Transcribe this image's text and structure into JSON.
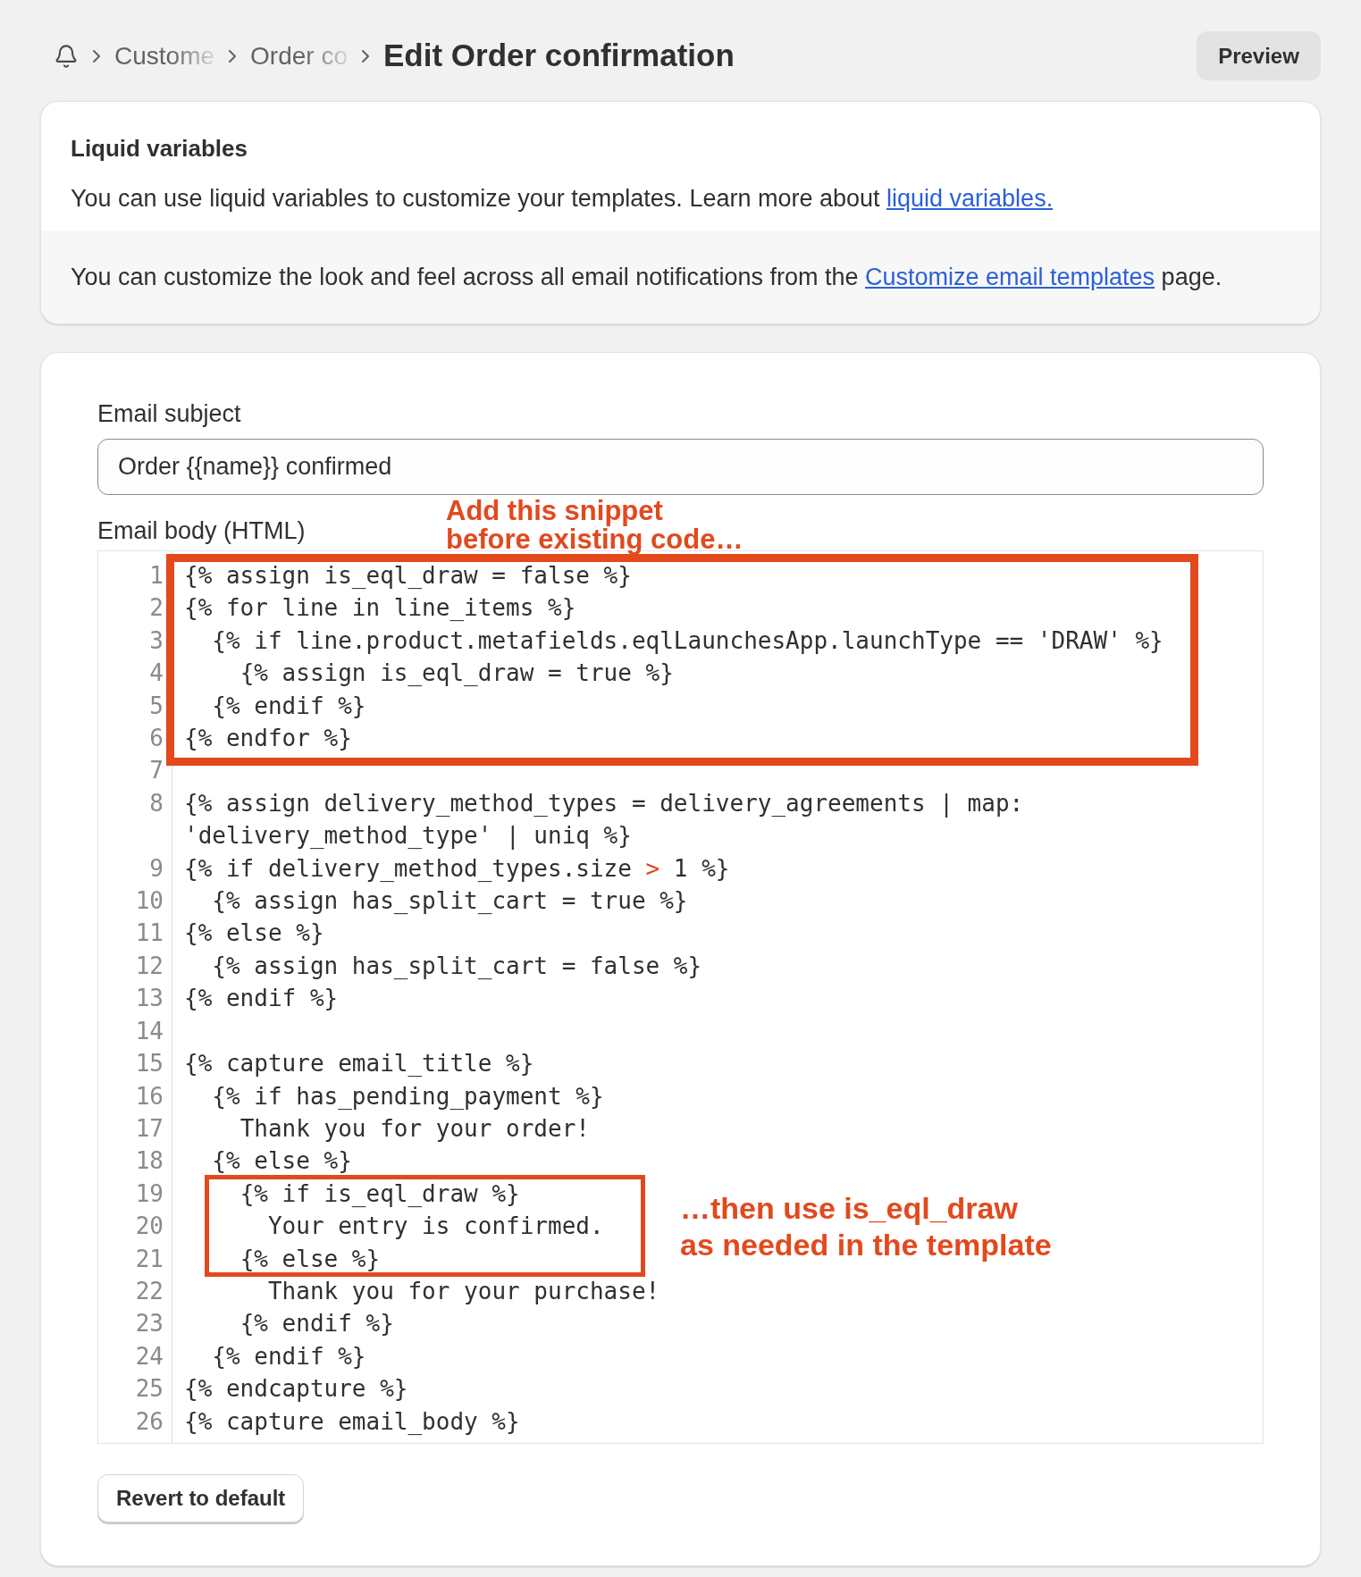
{
  "breadcrumbs": [
    {
      "label": "Custome"
    },
    {
      "label": "Order co"
    }
  ],
  "page_title": "Edit Order confirmation",
  "header_action": {
    "label": "Preview"
  },
  "info_card": {
    "title": "Liquid variables",
    "intro": {
      "text": "You can use liquid variables to customize your templates. Learn more about ",
      "link": "liquid variables."
    },
    "footer": {
      "text_before": "You can customize the look and feel across all email notifications from the ",
      "link": "Customize email templates",
      "text_after": " page."
    }
  },
  "form": {
    "subject": {
      "label": "Email subject",
      "value": "Order {{name}} confirmed"
    },
    "body": {
      "label": "Email body (HTML)",
      "lines": [
        {
          "number": "1",
          "tokens": [
            {
              "kind": "plain",
              "text": "{% assign is_eql_draw = false %}"
            }
          ]
        },
        {
          "number": "2",
          "tokens": [
            {
              "kind": "plain",
              "text": "{% for line in line_items %}"
            }
          ]
        },
        {
          "number": "3",
          "tokens": [
            {
              "kind": "plain",
              "text": "  {% if line.product.metafields.eqlLaunchesApp.launchType == 'DRAW' %}"
            }
          ]
        },
        {
          "number": "4",
          "tokens": [
            {
              "kind": "plain",
              "text": "    {% assign is_eql_draw = true %}"
            }
          ]
        },
        {
          "number": "5",
          "tokens": [
            {
              "kind": "plain",
              "text": "  {% endif %}"
            }
          ]
        },
        {
          "number": "6",
          "tokens": [
            {
              "kind": "plain",
              "text": "{% endfor %}"
            }
          ]
        },
        {
          "number": "7"
        },
        {
          "number": "8",
          "tokens": [
            {
              "kind": "plain",
              "text": "{% assign delivery_method_types = delivery_agreements | map: 'delivery_method_type' | uniq %}"
            }
          ]
        },
        {
          "number": "9",
          "tokens": [
            {
              "kind": "plain",
              "text": "{% if delivery_method_types.size "
            },
            {
              "kind": "operator",
              "text": ">"
            },
            {
              "kind": "plain",
              "text": " 1 %}"
            }
          ]
        },
        {
          "number": "10",
          "tokens": [
            {
              "kind": "plain",
              "text": "  {% assign has_split_cart = true %}"
            }
          ]
        },
        {
          "number": "11",
          "tokens": [
            {
              "kind": "plain",
              "text": "{% else %}"
            }
          ]
        },
        {
          "number": "12",
          "tokens": [
            {
              "kind": "plain",
              "text": "  {% assign has_split_cart = false %}"
            }
          ]
        },
        {
          "number": "13",
          "tokens": [
            {
              "kind": "plain",
              "text": "{% endif %}"
            }
          ]
        },
        {
          "number": "14"
        },
        {
          "number": "15",
          "tokens": [
            {
              "kind": "plain",
              "text": "{% capture email_title %}"
            }
          ]
        },
        {
          "number": "16",
          "tokens": [
            {
              "kind": "plain",
              "text": "  {% if has_pending_payment %}"
            }
          ]
        },
        {
          "number": "17",
          "tokens": [
            {
              "kind": "plain",
              "text": "    Thank you for your order!"
            }
          ]
        },
        {
          "number": "18",
          "tokens": [
            {
              "kind": "plain",
              "text": "  {% else %}"
            }
          ]
        },
        {
          "number": "19",
          "tokens": [
            {
              "kind": "plain",
              "text": "    {% if is_eql_draw %}"
            }
          ]
        },
        {
          "number": "20",
          "tokens": [
            {
              "kind": "plain",
              "text": "      Your entry is confirmed."
            }
          ]
        },
        {
          "number": "21",
          "tokens": [
            {
              "kind": "plain",
              "text": "    {% else %}"
            }
          ]
        },
        {
          "number": "22",
          "tokens": [
            {
              "kind": "plain",
              "text": "      Thank you for your purchase!"
            }
          ]
        },
        {
          "number": "23",
          "tokens": [
            {
              "kind": "plain",
              "text": "    {% endif %}"
            }
          ]
        },
        {
          "number": "24",
          "tokens": [
            {
              "kind": "plain",
              "text": "  {% endif %}"
            }
          ]
        },
        {
          "number": "25",
          "tokens": [
            {
              "kind": "plain",
              "text": "{% endcapture %}"
            }
          ]
        },
        {
          "number": "26",
          "tokens": [
            {
              "kind": "plain",
              "text": "{% capture email_body %}"
            }
          ]
        }
      ]
    },
    "revert_button": {
      "label": "Revert to default"
    }
  },
  "annotations": [
    {
      "lines": [
        "Add this snippet",
        "before existing code…"
      ]
    },
    {
      "lines": [
        "…then use is_eql_draw",
        "as needed in the template"
      ]
    }
  ]
}
